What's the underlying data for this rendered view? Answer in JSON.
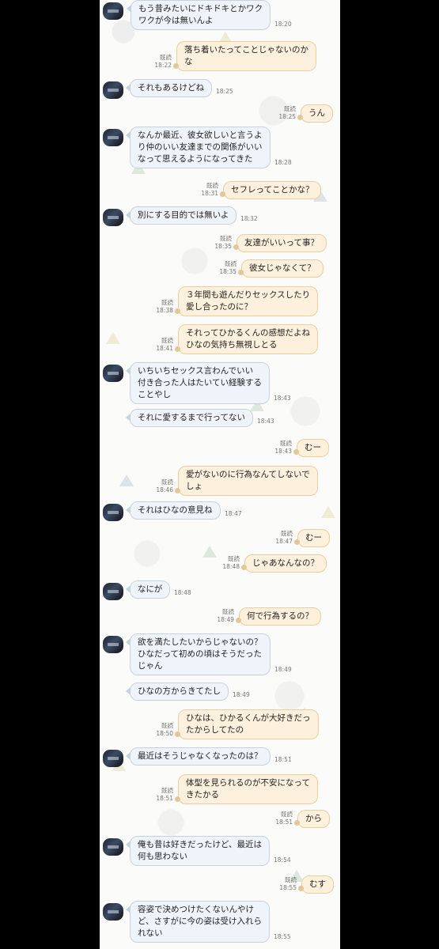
{
  "messages": [
    {
      "side": "in",
      "text": "もう昔みたいにドキドキとかワク\nワクが今は無いんよ",
      "time": "18:20"
    },
    {
      "side": "out",
      "text": "落ち着いたってことじゃないのか\nな",
      "read": "既読",
      "time": "18:22"
    },
    {
      "side": "in",
      "text": "それもあるけどね",
      "time": "18:25"
    },
    {
      "side": "out",
      "text": "うん",
      "read": "既読",
      "time": "18:25"
    },
    {
      "side": "in",
      "text": "なんか最近、彼女欲しいと言うよ\nり仲のいい友達までの関係がいい\nなって思えるようになってきた",
      "time": "18:28"
    },
    {
      "side": "out",
      "text": "セフレってことかな？",
      "read": "既読",
      "time": "18:31"
    },
    {
      "side": "in",
      "text": "別にする目的では無いよ",
      "time": "18:32"
    },
    {
      "side": "out",
      "text": "友達がいいって事？",
      "read": "既読",
      "time": "18:35"
    },
    {
      "side": "out",
      "text": "彼女じゃなくて？",
      "read": "既読",
      "time": "18:35"
    },
    {
      "side": "out",
      "text": "３年間も遊んだりセックスしたり\n愛し合ったのに？",
      "read": "既読",
      "time": "18:38"
    },
    {
      "side": "out",
      "text": "それってひかるくんの感想だよね\nひなの気持ち無視しとる",
      "read": "既読",
      "time": "18:41"
    },
    {
      "side": "in",
      "text": "いちいちセックス言わんでいい\n付き合った人はたいてい経験する\nことやし",
      "time": "18:43"
    },
    {
      "side": "in",
      "text": "それに愛するまで行ってない",
      "time": "18:43"
    },
    {
      "side": "out",
      "text": "むー",
      "read": "既読",
      "time": "18:43"
    },
    {
      "side": "out",
      "text": "愛がないのに行為なんてしないで\nしょ",
      "read": "既読",
      "time": "18:46"
    },
    {
      "side": "in",
      "text": "それはひなの意見ね",
      "time": "18:47"
    },
    {
      "side": "out",
      "text": "むー",
      "read": "既読",
      "time": "18:47"
    },
    {
      "side": "out",
      "text": "じゃあなんなの？",
      "read": "既読",
      "time": "18:48"
    },
    {
      "side": "in",
      "text": "なにが",
      "time": "18:48"
    },
    {
      "side": "out",
      "text": "何で行為するの？",
      "read": "既読",
      "time": "18:49"
    },
    {
      "side": "in",
      "text": "欲を満たしたいからじゃないの？\nひなだって初めの頃はそうだった\nじゃん",
      "time": "18:49"
    },
    {
      "side": "in",
      "text": "ひなの方からきてたし",
      "time": "18:49"
    },
    {
      "side": "out",
      "text": "ひなは、ひかるくんが大好きだっ\nたからしてたの",
      "read": "既読",
      "time": "18:50"
    },
    {
      "side": "in",
      "text": "最近はそうじゃなくなったのは？",
      "time": "18:51"
    },
    {
      "side": "out",
      "text": "体型を見られるのが不安になって\nきたかる",
      "read": "既読",
      "time": "18:51"
    },
    {
      "side": "out",
      "text": "から",
      "read": "既読",
      "time": "18:51"
    },
    {
      "side": "in",
      "text": "俺も昔は好きだったけど、最近は\n何も思わない",
      "time": "18:54"
    },
    {
      "side": "out",
      "text": "むす",
      "read": "既読",
      "time": "18:55"
    },
    {
      "side": "in",
      "text": "容姿で決めつけたくないんやけ\nど、さすがに今の姿は受け入れら\nれない",
      "time": "18:55"
    }
  ]
}
